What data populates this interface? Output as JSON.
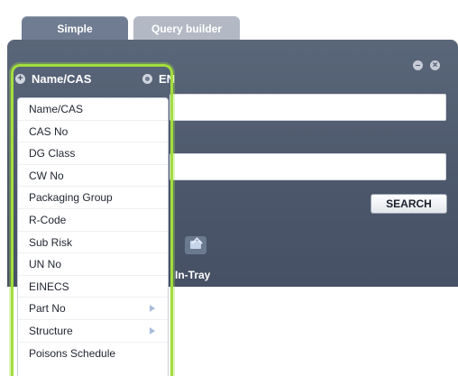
{
  "tabs": [
    {
      "label": "Simple"
    },
    {
      "label": "Query builder"
    }
  ],
  "panel": {
    "language_option": "EN",
    "search_button": "SEARCH",
    "in_tray_label": "In-Tray"
  },
  "dropdown": {
    "selected": "Name/CAS",
    "items": [
      {
        "label": "Name/CAS",
        "has_submenu": false
      },
      {
        "label": "CAS No",
        "has_submenu": false
      },
      {
        "label": "DG Class",
        "has_submenu": false
      },
      {
        "label": "CW No",
        "has_submenu": false
      },
      {
        "label": "Packaging Group",
        "has_submenu": false
      },
      {
        "label": "R-Code",
        "has_submenu": false
      },
      {
        "label": "Sub Risk",
        "has_submenu": false
      },
      {
        "label": "UN No",
        "has_submenu": false
      },
      {
        "label": "EINECS",
        "has_submenu": false
      },
      {
        "label": "Part No",
        "has_submenu": true
      },
      {
        "label": "Structure",
        "has_submenu": true
      },
      {
        "label": "Poisons Schedule",
        "has_submenu": false
      }
    ]
  },
  "colors": {
    "panel": "#4b566a",
    "active_tab": "#6f7c91",
    "inactive_tab": "#b3b9c4",
    "highlight": "#a2de3e"
  }
}
